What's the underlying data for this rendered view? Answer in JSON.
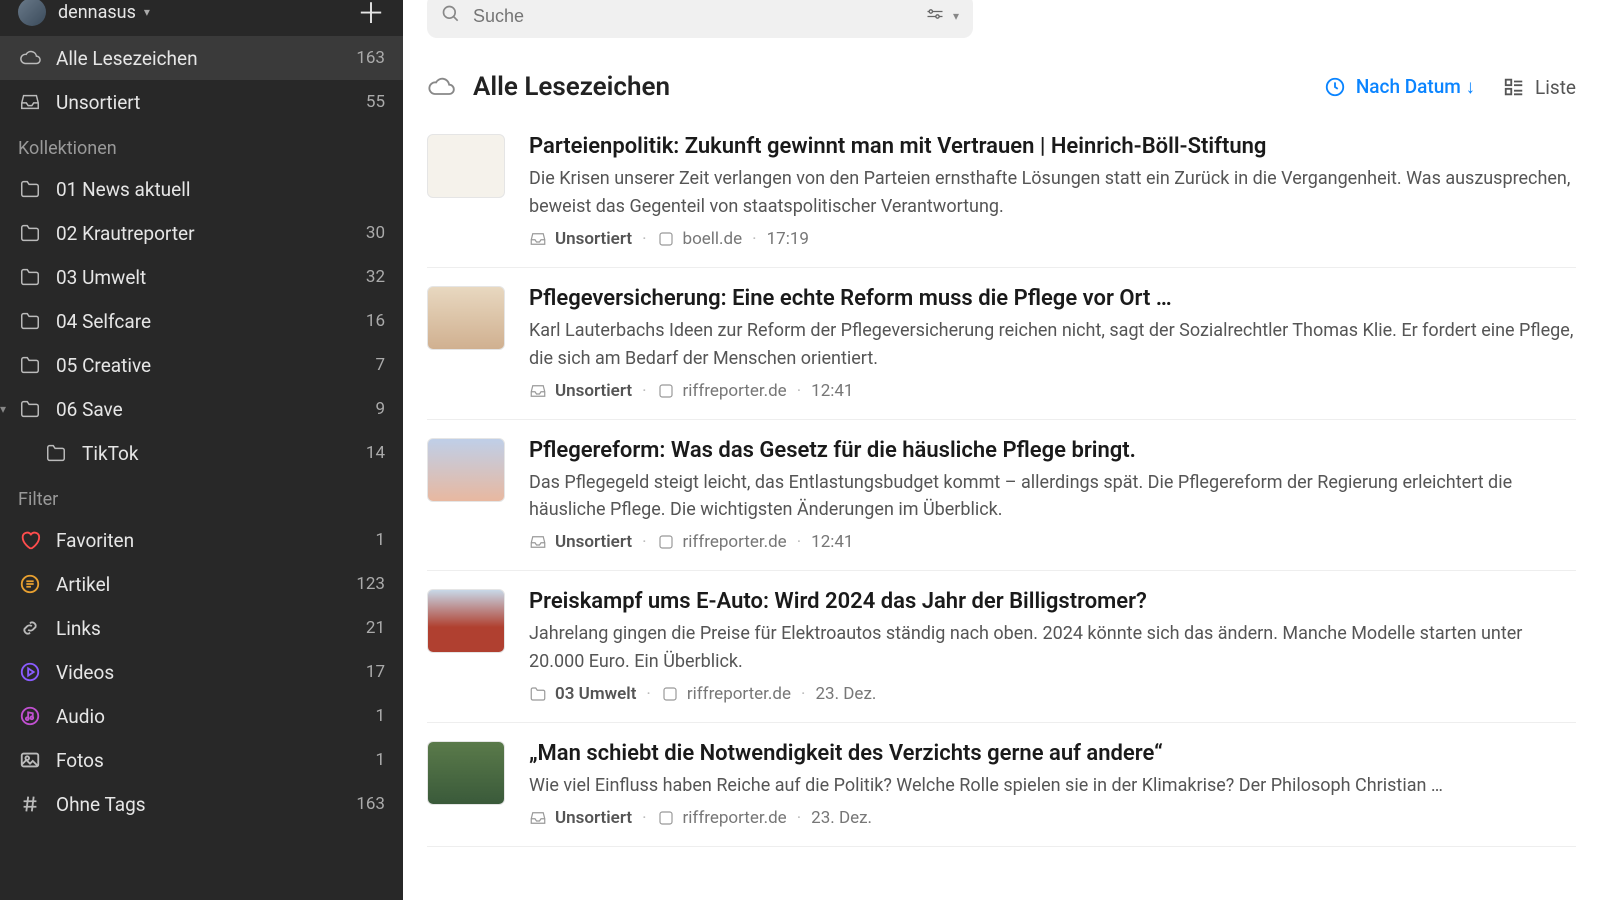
{
  "user": {
    "name": "dennasus"
  },
  "sidebar": {
    "all": {
      "label": "Alle Lesezeichen",
      "count": "163"
    },
    "unsorted": {
      "label": "Unsortiert",
      "count": "55"
    },
    "section_collections": "Kollektionen",
    "collections": [
      {
        "label": "01 News aktuell",
        "count": ""
      },
      {
        "label": "02 Krautreporter",
        "count": "30"
      },
      {
        "label": "03 Umwelt",
        "count": "32"
      },
      {
        "label": "04 Selfcare",
        "count": "16"
      },
      {
        "label": "05 Creative",
        "count": "7"
      },
      {
        "label": "06 Save",
        "count": "9",
        "expanded": true
      },
      {
        "label": "TikTok",
        "count": "14",
        "sub": true
      }
    ],
    "section_filter": "Filter",
    "filters": [
      {
        "label": "Favoriten",
        "count": "1",
        "icon": "heart",
        "color": "#ff4d4d"
      },
      {
        "label": "Artikel",
        "count": "123",
        "icon": "article",
        "color": "#e8a030"
      },
      {
        "label": "Links",
        "count": "21",
        "icon": "link",
        "color": "#bbb"
      },
      {
        "label": "Videos",
        "count": "17",
        "icon": "video",
        "color": "#8a5cff"
      },
      {
        "label": "Audio",
        "count": "1",
        "icon": "audio",
        "color": "#c050d0"
      },
      {
        "label": "Fotos",
        "count": "1",
        "icon": "photo",
        "color": "#bbb"
      },
      {
        "label": "Ohne Tags",
        "count": "163",
        "icon": "hash",
        "color": "#bbb"
      }
    ]
  },
  "search": {
    "placeholder": "Suche"
  },
  "header": {
    "title": "Alle Lesezeichen",
    "sort_label": "Nach Datum ↓",
    "view_label": "Liste"
  },
  "items": [
    {
      "title": "Parteienpolitik: Zukunft gewinnt man mit Vertrauen | Heinrich-Böll-Stiftung",
      "desc": "Die Krisen unserer Zeit verlangen von den Parteien ernsthafte Lösungen statt ein Zurück in die Vergangenheit. Was auszusprechen, beweist das Gegenteil von staatspolitischer Verantwortung.",
      "collection": "Unsortiert",
      "coll_icon": "inbox",
      "domain": "boell.de",
      "time": "17:19"
    },
    {
      "title": "Pflegeversicherung: Eine echte Reform muss die Pflege vor Ort …",
      "desc": "Karl Lauterbachs Ideen zur Reform der Pflegeversicherung reichen nicht, sagt der Sozialrechtler Thomas Klie. Er fordert eine Pflege, die sich am Bedarf der Menschen orientiert.",
      "collection": "Unsortiert",
      "coll_icon": "inbox",
      "domain": "riffreporter.de",
      "time": "12:41"
    },
    {
      "title": "Pflegereform: Was das Gesetz für die häusliche Pflege bringt.",
      "desc": "Das Pflegegeld steigt leicht, das Entlastungsbudget kommt – allerdings spät. Die Pflegereform der Regierung erleichtert die häusliche Pflege. Die wichtigsten Änderungen im Überblick.",
      "collection": "Unsortiert",
      "coll_icon": "inbox",
      "domain": "riffreporter.de",
      "time": "12:41"
    },
    {
      "title": "Preiskampf ums E-Auto: Wird 2024 das Jahr der Billigstromer?",
      "desc": "Jahrelang gingen die Preise für Elektroautos ständig nach oben. 2024 könnte sich das ändern. Manche Modelle starten unter 20.000 Euro. Ein Überblick.",
      "collection": "03 Umwelt",
      "coll_icon": "folder",
      "domain": "riffreporter.de",
      "time": "23. Dez."
    },
    {
      "title": "„Man schiebt die Notwendigkeit des Verzichts gerne auf andere“",
      "desc": "Wie viel Einfluss haben Reiche auf die Politik? Welche Rolle spielen sie in der Klimakrise? Der Philosoph Christian …",
      "collection": "Unsortiert",
      "coll_icon": "inbox",
      "domain": "riffreporter.de",
      "time": "23. Dez."
    }
  ]
}
